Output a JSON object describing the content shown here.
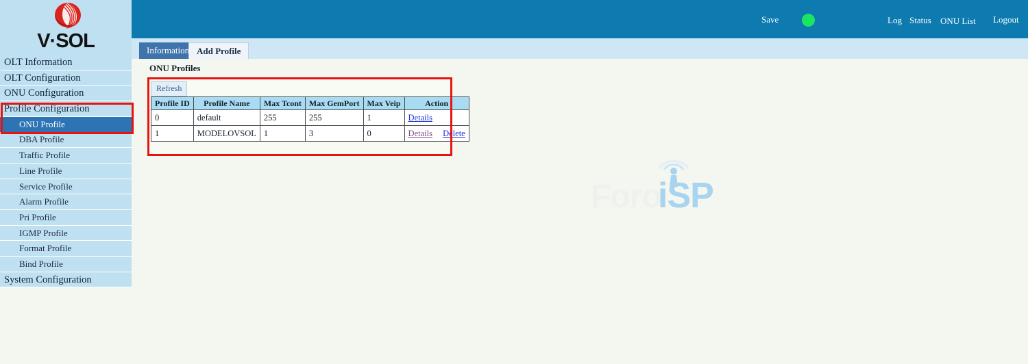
{
  "brand": {
    "name": "V·SOL",
    "logo_icon": "vsol-swirl-logo-icon",
    "logo_color": "#d9241f"
  },
  "topbar": {
    "save_label": "Save",
    "status_indicator_color": "#19e562",
    "status_indicator_icon": "green-status-dot-icon",
    "links": [
      {
        "label": "Log"
      },
      {
        "label": "Status"
      },
      {
        "label": "ONU List"
      },
      {
        "label": "Logout"
      }
    ],
    "background_color": "#0e7bb0"
  },
  "sidebar": {
    "background_color": "#bfe0f0",
    "selected_color": "#2e74b5",
    "items": [
      {
        "label": "OLT Information",
        "level": 1,
        "selected": false
      },
      {
        "label": "OLT Configuration",
        "level": 1,
        "selected": false
      },
      {
        "label": "ONU Configuration",
        "level": 1,
        "selected": false
      },
      {
        "label": "Profile Configuration",
        "level": 1,
        "selected": false
      },
      {
        "label": "ONU Profile",
        "level": 2,
        "selected": true
      },
      {
        "label": "DBA Profile",
        "level": 2,
        "selected": false
      },
      {
        "label": "Traffic Profile",
        "level": 2,
        "selected": false
      },
      {
        "label": "Line Profile",
        "level": 2,
        "selected": false
      },
      {
        "label": "Service Profile",
        "level": 2,
        "selected": false
      },
      {
        "label": "Alarm Profile",
        "level": 2,
        "selected": false
      },
      {
        "label": "Pri Profile",
        "level": 2,
        "selected": false
      },
      {
        "label": "IGMP Profile",
        "level": 2,
        "selected": false
      },
      {
        "label": "Format Profile",
        "level": 2,
        "selected": false
      },
      {
        "label": "Bind Profile",
        "level": 2,
        "selected": false
      },
      {
        "label": "System Configuration",
        "level": 1,
        "selected": false
      }
    ]
  },
  "tabs": [
    {
      "label": "Information",
      "active": true
    },
    {
      "label": "Add Profile",
      "active": false
    }
  ],
  "main": {
    "section_title": "ONU Profiles",
    "refresh_label": "Refresh",
    "table": {
      "headers": [
        "Profile ID",
        "Profile Name",
        "Max Tcont",
        "Max GemPort",
        "Max Veip",
        "Action"
      ],
      "rows": [
        {
          "profile_id": "0",
          "profile_name": "default",
          "max_tcont": "255",
          "max_gemport": "255",
          "max_veip": "1",
          "actions": [
            {
              "label": "Details",
              "state": "unvisited"
            }
          ]
        },
        {
          "profile_id": "1",
          "profile_name": "MODELOVSOL",
          "max_tcont": "1",
          "max_gemport": "3",
          "max_veip": "0",
          "actions": [
            {
              "label": "Details",
              "state": "visited"
            },
            {
              "label": "Delete",
              "state": "unvisited"
            }
          ]
        }
      ]
    }
  },
  "annotations": {
    "highlight_color": "#e8130e",
    "boxes": [
      {
        "target": "sidebar-profile-configuration-group"
      },
      {
        "target": "onu-profiles-table-panel"
      }
    ]
  },
  "watermark": {
    "text_primary": "Foro",
    "text_secondary": "iSP",
    "icon": "antenna-tower-icon",
    "color_primary": "#eef2ef",
    "color_secondary": "#a8d4ef"
  }
}
